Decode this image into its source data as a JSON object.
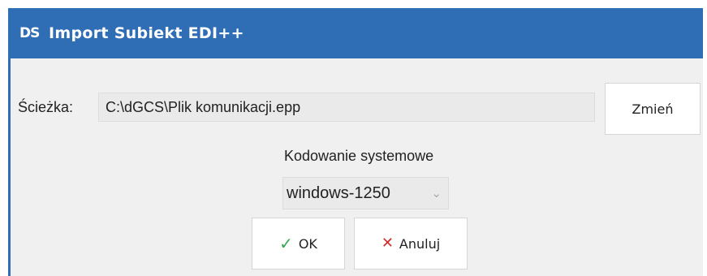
{
  "window": {
    "title": "Import Subiekt EDI++",
    "logo": "DS"
  },
  "path": {
    "label": "Ścieżka:",
    "value": "C:\\dGCS\\Plik komunikacji.epp",
    "change_button": "Zmień"
  },
  "encoding": {
    "label": "Kodowanie systemowe",
    "selected": "windows-1250"
  },
  "actions": {
    "ok": "OK",
    "cancel": "Anuluj"
  },
  "icons": {
    "ok_icon": "check-icon",
    "cancel_icon": "x-icon"
  },
  "colors": {
    "titlebar": "#2f6db5",
    "ok_icon": "#32a852",
    "cancel_icon": "#d42a2a"
  }
}
